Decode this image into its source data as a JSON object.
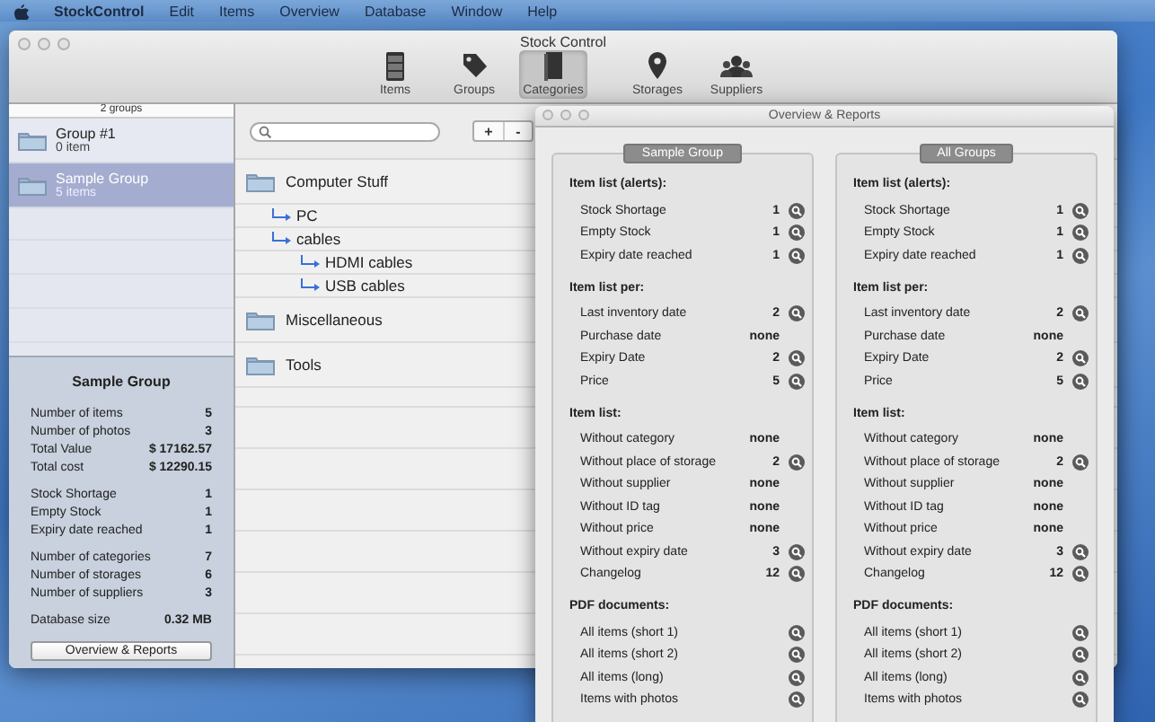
{
  "menubar": {
    "app": "StockControl",
    "items": [
      "Edit",
      "Items",
      "Overview",
      "Database",
      "Window",
      "Help"
    ]
  },
  "main_window": {
    "title": "Stock Control",
    "toolbar": [
      {
        "label": "Items",
        "selected": false
      },
      {
        "label": "Groups",
        "selected": false
      },
      {
        "label": "Categories",
        "selected": true
      },
      {
        "label": "Storages",
        "selected": false
      },
      {
        "label": "Suppliers",
        "selected": false
      }
    ],
    "groups": {
      "count": "2 groups",
      "items": [
        {
          "name": "Group #1",
          "subtitle": "0 item",
          "selected": false
        },
        {
          "name": "Sample Group",
          "subtitle": "5 items",
          "selected": true
        }
      ]
    },
    "summary": {
      "title": "Sample Group",
      "sections": [
        [
          {
            "label": "Number of items",
            "value": "5"
          },
          {
            "label": "Number of photos",
            "value": "3"
          },
          {
            "label": "Total Value",
            "value": "$ 17162.57"
          },
          {
            "label": "Total cost",
            "value": "$ 12290.15"
          }
        ],
        [
          {
            "label": "Stock Shortage",
            "value": "1"
          },
          {
            "label": "Empty Stock",
            "value": "1"
          },
          {
            "label": "Expiry date reached",
            "value": "1"
          }
        ],
        [
          {
            "label": "Number of categories",
            "value": "7"
          },
          {
            "label": "Number of storages",
            "value": "6"
          },
          {
            "label": "Number of suppliers",
            "value": "3"
          }
        ],
        [
          {
            "label": "Database size",
            "value": "0.32 MB"
          }
        ]
      ],
      "button": "Overview & Reports"
    },
    "add_buttons": [
      "+",
      "-"
    ],
    "categories": [
      {
        "name": "Computer Stuff",
        "children": [
          {
            "name": "PC"
          },
          {
            "name": "cables",
            "children": [
              {
                "name": "HDMI cables"
              },
              {
                "name": "USB cables"
              }
            ]
          }
        ]
      },
      {
        "name": "Miscellaneous"
      },
      {
        "name": "Tools"
      }
    ]
  },
  "overview_window": {
    "title": "Overview & Reports",
    "panels": [
      {
        "title": "Sample Group",
        "sections": [
          {
            "heading": "Item list (alerts):",
            "rows": [
              {
                "label": "Stock Shortage",
                "value": "1",
                "button": true
              },
              {
                "label": "Empty Stock",
                "value": "1",
                "button": true
              },
              {
                "label": "Expiry date reached",
                "value": "1",
                "button": true
              }
            ]
          },
          {
            "heading": "Item list per:",
            "rows": [
              {
                "label": "Last inventory date",
                "value": "2",
                "button": true
              },
              {
                "label": "Purchase date",
                "value": "none",
                "button": false
              },
              {
                "label": "Expiry Date",
                "value": "2",
                "button": true
              },
              {
                "label": "Price",
                "value": "5",
                "button": true
              }
            ]
          },
          {
            "heading": "Item list:",
            "rows": [
              {
                "label": "Without category",
                "value": "none",
                "button": false
              },
              {
                "label": "Without place of storage",
                "value": "2",
                "button": true
              },
              {
                "label": "Without supplier",
                "value": "none",
                "button": false
              },
              {
                "label": "Without ID tag",
                "value": "none",
                "button": false
              },
              {
                "label": "Without price",
                "value": "none",
                "button": false
              },
              {
                "label": "Without expiry date",
                "value": "3",
                "button": true
              },
              {
                "label": "Changelog",
                "value": "12",
                "button": true
              }
            ]
          },
          {
            "heading": "PDF documents:",
            "rows": [
              {
                "label": "All items (short 1)",
                "button": true
              },
              {
                "label": "All items (short 2)",
                "button": true
              },
              {
                "label": "All items (long)",
                "button": true
              },
              {
                "label": "Items with photos",
                "button": true
              }
            ]
          }
        ]
      },
      {
        "title": "All Groups",
        "sections": [
          {
            "heading": "Item list (alerts):",
            "rows": [
              {
                "label": "Stock Shortage",
                "value": "1",
                "button": true
              },
              {
                "label": "Empty Stock",
                "value": "1",
                "button": true
              },
              {
                "label": "Expiry date reached",
                "value": "1",
                "button": true
              }
            ]
          },
          {
            "heading": "Item list per:",
            "rows": [
              {
                "label": "Last inventory date",
                "value": "2",
                "button": true
              },
              {
                "label": "Purchase date",
                "value": "none",
                "button": false
              },
              {
                "label": "Expiry Date",
                "value": "2",
                "button": true
              },
              {
                "label": "Price",
                "value": "5",
                "button": true
              }
            ]
          },
          {
            "heading": "Item list:",
            "rows": [
              {
                "label": "Without category",
                "value": "none",
                "button": false
              },
              {
                "label": "Without place of storage",
                "value": "2",
                "button": true
              },
              {
                "label": "Without supplier",
                "value": "none",
                "button": false
              },
              {
                "label": "Without ID tag",
                "value": "none",
                "button": false
              },
              {
                "label": "Without price",
                "value": "none",
                "button": false
              },
              {
                "label": "Without expiry date",
                "value": "3",
                "button": true
              },
              {
                "label": "Changelog",
                "value": "12",
                "button": true
              }
            ]
          },
          {
            "heading": "PDF documents:",
            "rows": [
              {
                "label": "All items (short 1)",
                "button": true
              },
              {
                "label": "All items (short 2)",
                "button": true
              },
              {
                "label": "All items (long)",
                "button": true
              },
              {
                "label": "Items with photos",
                "button": true
              }
            ]
          }
        ]
      }
    ]
  }
}
